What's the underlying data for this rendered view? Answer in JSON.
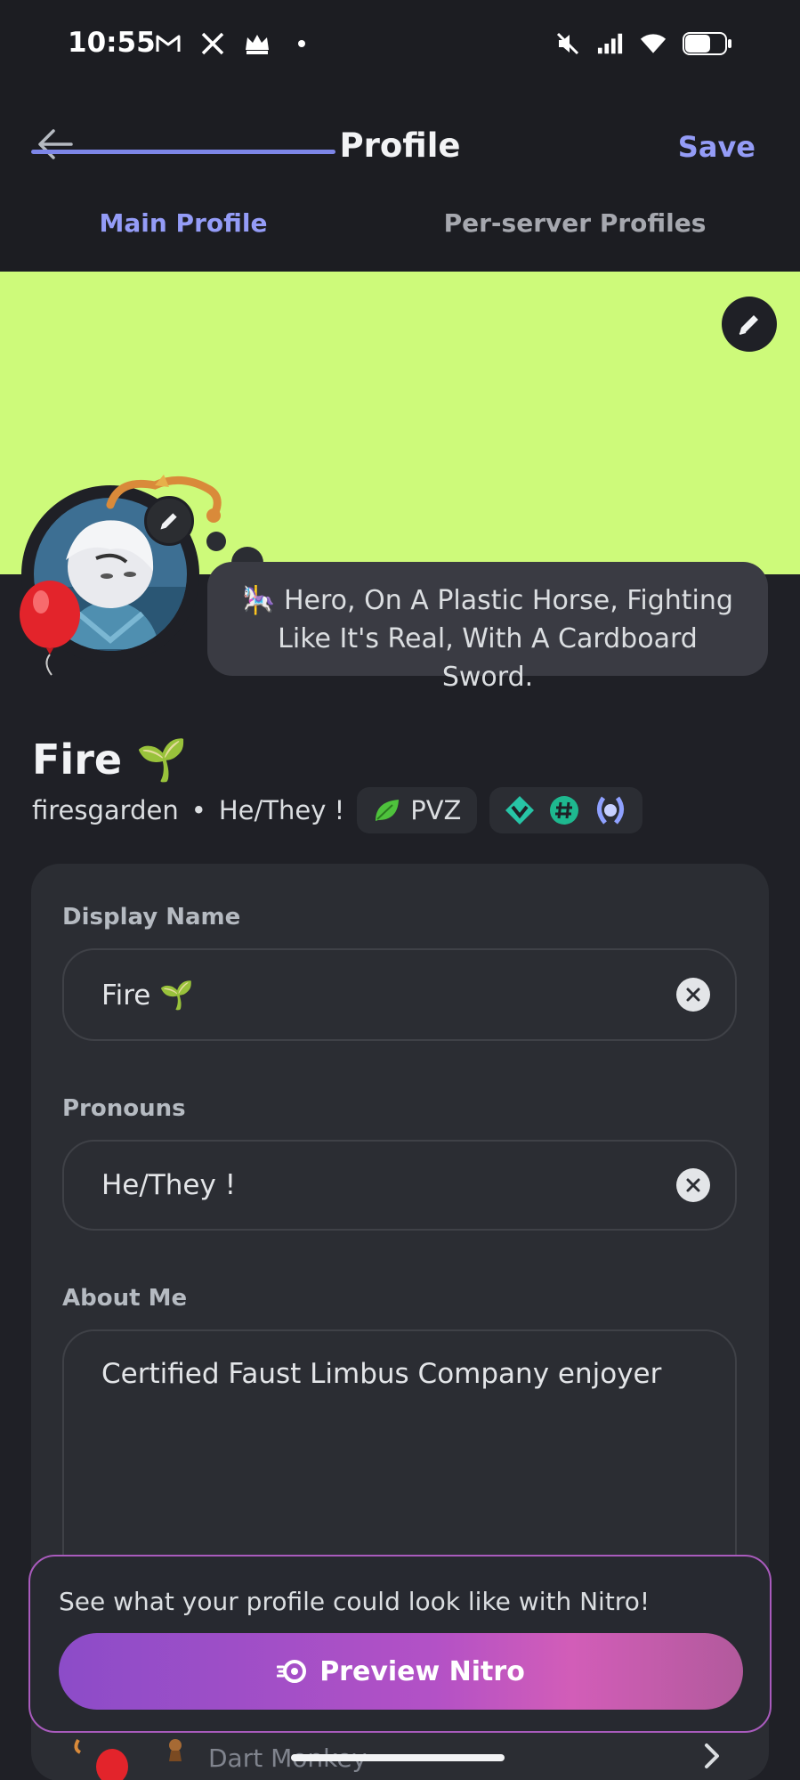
{
  "status_bar": {
    "time": "10:55",
    "left_icons": [
      "gmail-icon",
      "x-icon",
      "crown-icon",
      "dot-icon"
    ],
    "right_icons": [
      "mute-icon",
      "signal-icon",
      "wifi-icon",
      "battery-icon"
    ]
  },
  "header": {
    "title": "Profile",
    "save_label": "Save",
    "back_icon": "arrow-left-icon"
  },
  "tabs": [
    {
      "label": "Main Profile",
      "active": true
    },
    {
      "label": "Per-server Profiles",
      "active": false
    }
  ],
  "banner": {
    "color": "#cdfa7a",
    "edit_icon": "pencil-icon"
  },
  "profile": {
    "status_emoji": "🎠",
    "status_text": "Hero, On A Plastic Horse, Fighting Like It's Real, With A Cardboard Sword.",
    "display_name": "Fire 🌱",
    "username": "firesgarden",
    "separator": "•",
    "pronouns": "He/They !",
    "tag_icon": "leaf-icon",
    "tag_label": "PVZ",
    "badges": [
      "hypesquad-icon",
      "hashtag-icon",
      "laurel-icon"
    ]
  },
  "form": {
    "display_name_label": "Display Name",
    "display_name_value": "Fire 🌱",
    "pronouns_label": "Pronouns",
    "pronouns_value": "He/They !",
    "about_label": "About Me",
    "about_value": "Certified Faust Limbus Company enjoyer"
  },
  "nitro": {
    "prompt": "See what your profile could look like with Nitro!",
    "button_label": "Preview Nitro",
    "button_icon": "nitro-icon"
  },
  "peek_item": {
    "label": "Dart Monkey"
  },
  "colors": {
    "accent": "#949cf7",
    "background": "#1f2026",
    "card": "#2b2d33",
    "banner": "#cdfa7a"
  }
}
